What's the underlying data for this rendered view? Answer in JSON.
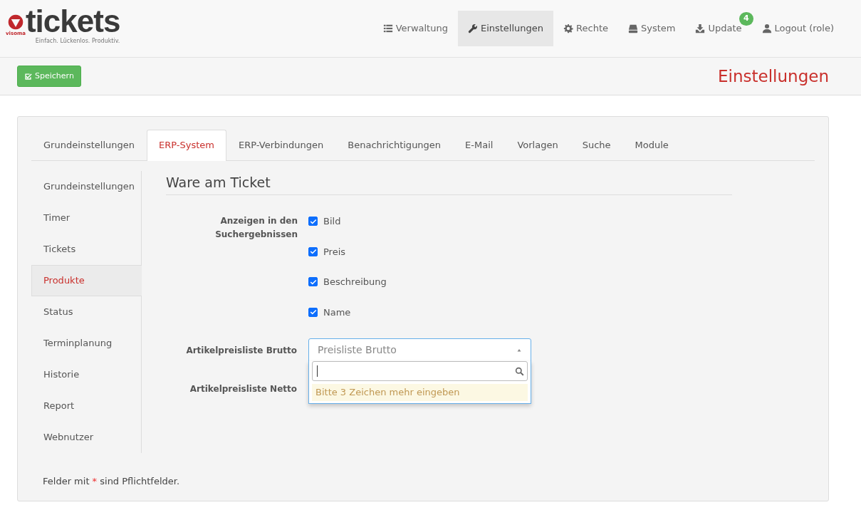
{
  "logo": {
    "wordmark": "tickets",
    "brand": "visoma",
    "tagline": "Einfach. Lückenlos. Produktiv."
  },
  "nav": [
    {
      "label": "Verwaltung",
      "selected": false
    },
    {
      "label": "Einstellungen",
      "selected": true
    },
    {
      "label": "Rechte",
      "selected": false
    },
    {
      "label": "System",
      "selected": false
    },
    {
      "label": "Update",
      "selected": false,
      "badge": "4"
    },
    {
      "label": "Logout (role)",
      "selected": false
    }
  ],
  "toolbar": {
    "save_button": "Speichern",
    "page_title": "Einstellungen"
  },
  "tabs": [
    {
      "label": "Grundeinstellungen",
      "selected": false
    },
    {
      "label": "ERP-System",
      "selected": true
    },
    {
      "label": "ERP-Verbindungen",
      "selected": false
    },
    {
      "label": "Benachrichtigungen",
      "selected": false
    },
    {
      "label": "E-Mail",
      "selected": false
    },
    {
      "label": "Vorlagen",
      "selected": false
    },
    {
      "label": "Suche",
      "selected": false
    },
    {
      "label": "Module",
      "selected": false
    }
  ],
  "sidebar": {
    "items": [
      {
        "label": "Grundeinstellungen",
        "selected": false
      },
      {
        "label": "Timer",
        "selected": false
      },
      {
        "label": "Tickets",
        "selected": false
      },
      {
        "label": "Produkte",
        "selected": true
      },
      {
        "label": "Status",
        "selected": false
      },
      {
        "label": "Terminplanung",
        "selected": false
      },
      {
        "label": "Historie",
        "selected": false
      },
      {
        "label": "Report",
        "selected": false
      },
      {
        "label": "Webnutzer",
        "selected": false
      }
    ]
  },
  "section_title": "Ware am Ticket",
  "search_results": {
    "label": "Anzeigen in den Suchergebnissen",
    "options": [
      {
        "label": "Bild",
        "checked": true
      },
      {
        "label": "Preis",
        "checked": true
      },
      {
        "label": "Beschreibung",
        "checked": true
      },
      {
        "label": "Name",
        "checked": true
      }
    ]
  },
  "selects": [
    {
      "label": "Artikelpreisliste Brutto",
      "value": "Preisliste Brutto",
      "expanded": true,
      "message": "Bitte 3 Zeichen mehr eingeben"
    },
    {
      "label": "Artikelpreisliste Netto",
      "expanded": false
    }
  ],
  "footnote": {
    "before": "Felder mit",
    "mark": "*",
    "after": "sind Pflichtfelder."
  }
}
